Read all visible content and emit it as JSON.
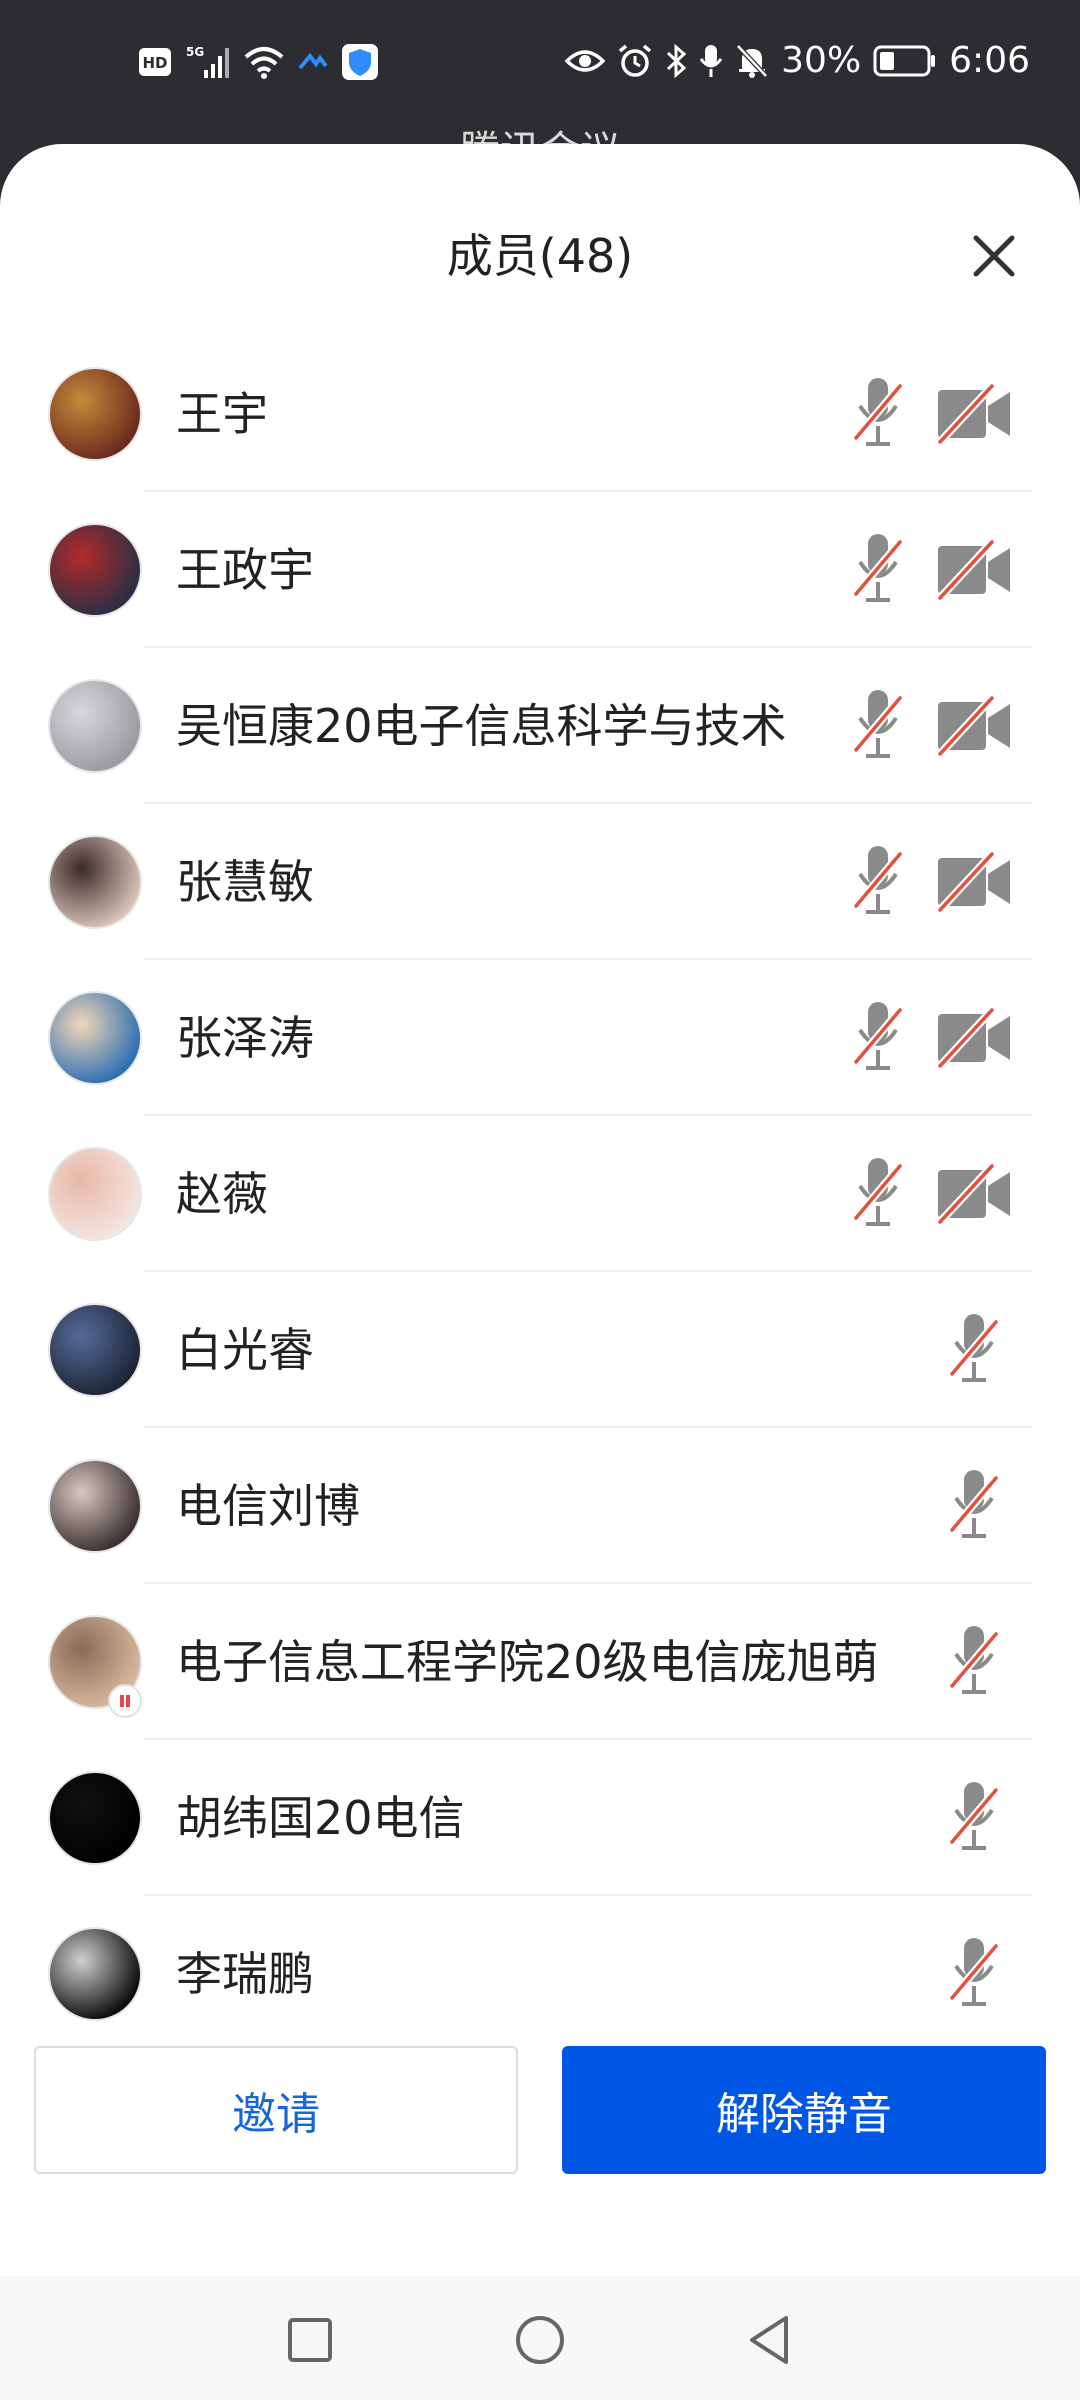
{
  "status_bar": {
    "left_icons": [
      "hd-icon",
      "5g-signal-icon",
      "wifi-icon",
      "meeting-app-icon",
      "shield-app-icon"
    ],
    "hd_label": "HD",
    "network_label": "5G",
    "right_icons": [
      "eye-icon",
      "alarm-icon",
      "bluetooth-icon",
      "microphone-icon",
      "mute-bell-icon",
      "battery-icon"
    ],
    "battery": "30%",
    "time": "6:06"
  },
  "background_title": "腾讯会议",
  "sheet": {
    "title": "成员(48)"
  },
  "members": [
    {
      "name": "王宇",
      "mic_muted": true,
      "camera_off": true
    },
    {
      "name": "王政宇",
      "mic_muted": true,
      "camera_off": true
    },
    {
      "name": "吴恒康20电子信息科学与技术",
      "mic_muted": true,
      "camera_off": true
    },
    {
      "name": "张慧敏",
      "mic_muted": true,
      "camera_off": true
    },
    {
      "name": "张泽涛",
      "mic_muted": true,
      "camera_off": true
    },
    {
      "name": "赵薇",
      "mic_muted": true,
      "camera_off": true
    },
    {
      "name": "白光睿",
      "mic_muted": true
    },
    {
      "name": "电信刘博",
      "mic_muted": true
    },
    {
      "name": "电子信息工程学院20级电信庞旭萌",
      "mic_muted": true,
      "recording": true
    },
    {
      "name": "胡纬国20电信",
      "mic_muted": true
    },
    {
      "name": "李瑞鹏",
      "mic_muted": true
    }
  ],
  "buttons": {
    "invite": "邀请",
    "unmute": "解除静音"
  },
  "colors": {
    "primary": "#0057e6",
    "invite_text": "#1766d8",
    "mute_slash": "#e0523d",
    "icon_gray": "#8a8a8a"
  },
  "nav": [
    "recent-apps-icon",
    "home-icon",
    "back-icon"
  ]
}
